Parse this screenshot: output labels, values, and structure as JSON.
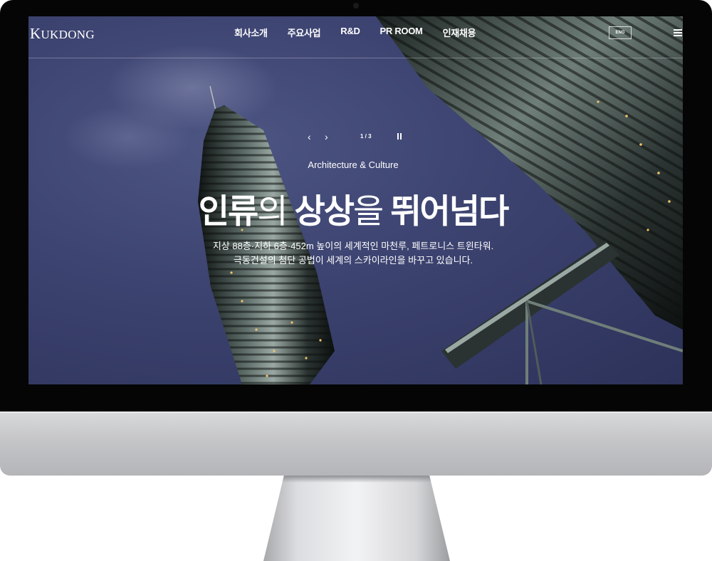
{
  "header": {
    "logo_text": "KUKDONG",
    "nav": [
      "회사소개",
      "주요사업",
      "R&D",
      "PR ROOM",
      "인재채용"
    ],
    "lang_button": "ENG",
    "menu_icon": "hamburger-menu-icon"
  },
  "slider": {
    "prev_icon": "chevron-left-icon",
    "next_icon": "chevron-right-icon",
    "counter": "1 / 3",
    "pause_icon": "pause-icon"
  },
  "hero": {
    "tagline": "Architecture & Culture",
    "headline": {
      "part1": "인류",
      "part2": "의 ",
      "part3": "상상",
      "part4": "을 ",
      "part5": "뛰어넘다"
    },
    "desc_line1": "지상 88층·지하 6층·452m 높이의 세계적인 마천루, 페트로니스 트윈타워.",
    "desc_line2": "극동건설의 첨단 공법이 세계의 스카이라인을 바꾸고 있습니다."
  },
  "colors": {
    "sky": "#3d4471",
    "tower": "#171d1b",
    "tower_highlight": "#8fa09a",
    "lights": "#f0c46a"
  }
}
